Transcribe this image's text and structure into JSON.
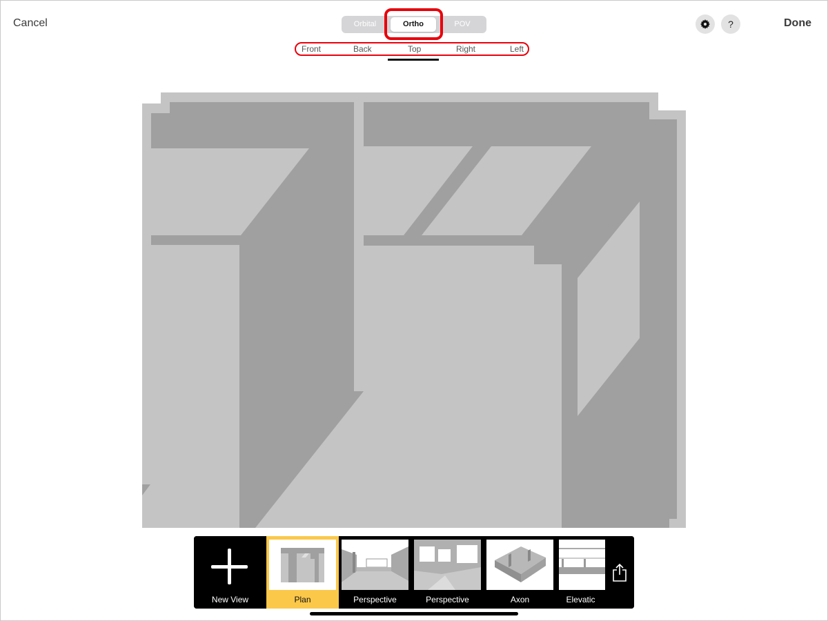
{
  "header": {
    "cancel_label": "Cancel",
    "done_label": "Done",
    "settings_icon": "gear-icon",
    "help_label": "?"
  },
  "mode_segment": {
    "items": [
      "Orbital",
      "Ortho",
      "POV"
    ],
    "selected": "Ortho"
  },
  "view_tabs": {
    "items": [
      "Front",
      "Back",
      "Top",
      "Right",
      "Left"
    ],
    "selected": "Top"
  },
  "colors": {
    "highlight": "#e8000b",
    "selected_card": "#fbc84a",
    "floor": "#c4c4c4",
    "wall": "#a0a0a0"
  },
  "thumbnails": {
    "new_view_label": "New View",
    "items": [
      {
        "label": "Plan",
        "selected": true
      },
      {
        "label": "Perspective",
        "selected": false
      },
      {
        "label": "Perspective",
        "selected": false
      },
      {
        "label": "Axon",
        "selected": false
      },
      {
        "label": "Elevatic",
        "selected": false
      }
    ],
    "share_icon": "share-icon"
  }
}
